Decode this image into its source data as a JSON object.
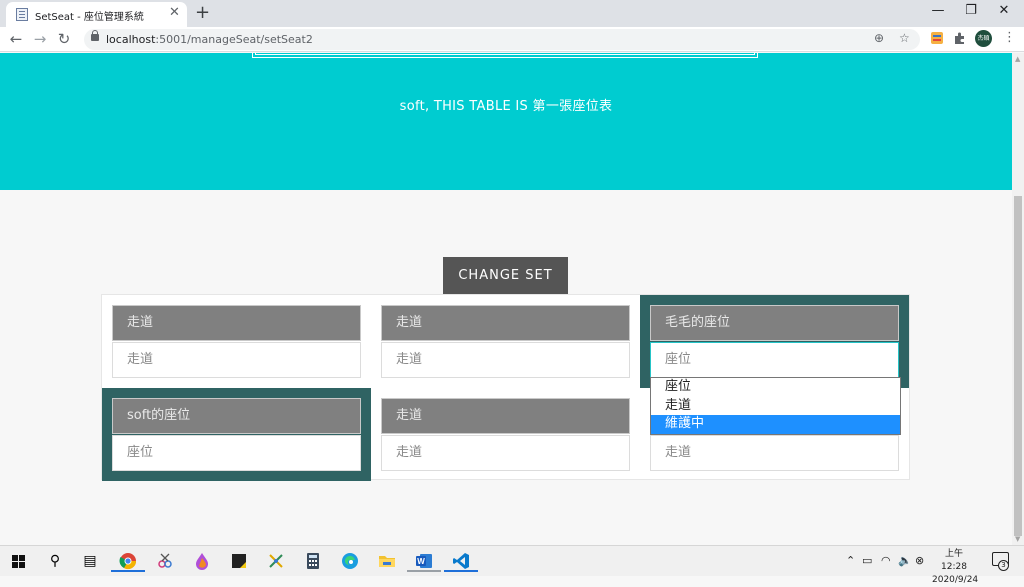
{
  "browser": {
    "tab_title": "SetSeat - 座位管理系統",
    "tab_close": "✕",
    "new_tab": "+",
    "window": {
      "minimize": "—",
      "restore": "❐",
      "close": "✕"
    },
    "url_host": "localhost",
    "url_path": ":5001/manageSeat/setSeat2",
    "profile_label": "杰碩"
  },
  "page": {
    "hero_text": "soft, THIS TABLE IS 第一張座位表",
    "change_button": "CHANGE SET",
    "cells": [
      {
        "title": "走道",
        "value": "走道"
      },
      {
        "title": "走道",
        "value": "走道"
      },
      {
        "title": "毛毛的座位",
        "value": "座位"
      },
      {
        "title": "soft的座位",
        "value": "座位"
      },
      {
        "title": "走道",
        "value": "走道"
      },
      {
        "title": "",
        "value": "走道"
      }
    ],
    "dropdown": {
      "options": [
        "座位",
        "走道",
        "維護中"
      ],
      "highlighted": "維護中"
    }
  },
  "taskbar": {
    "clock_time": "上午 12:28",
    "clock_date": "2020/9/24",
    "notification_count": "3"
  }
}
